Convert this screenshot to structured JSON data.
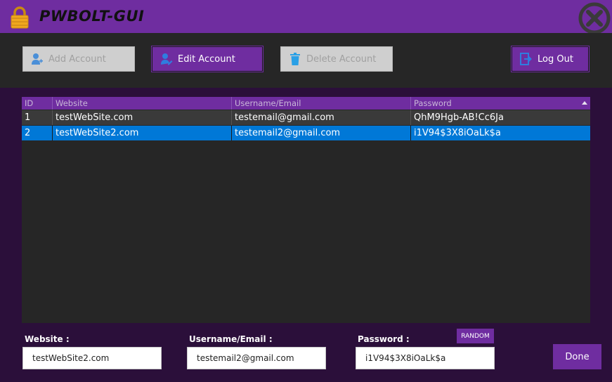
{
  "window": {
    "title": "PWBOLT-GUI",
    "close_icon": "close-x-circle-icon",
    "lock_icon": "padlock-icon"
  },
  "toolbar": {
    "add_label": "Add Account",
    "edit_label": "Edit Account",
    "delete_label": "Delete Account",
    "logout_label": "Log Out"
  },
  "table": {
    "columns": [
      "ID",
      "Website",
      "Username/Email",
      "Password"
    ],
    "sort_column": "Password",
    "rows": [
      {
        "id": "1",
        "website": "testWebSite.com",
        "email": "testemail@gmail.com",
        "password": "QhM9Hgb-AB!Cc6Ja"
      },
      {
        "id": "2",
        "website": "testWebSite2.com",
        "email": "testemail2@gmail.com",
        "password": "i1V94$3X8iOaLk$a"
      }
    ],
    "selected_row": "2"
  },
  "form": {
    "website_label": "Website :",
    "website_value": "testWebSite2.com",
    "email_label": "Username/Email :",
    "email_value": "testemail2@gmail.com",
    "password_label": "Password :",
    "password_value": "i1V94$3X8iOaLk$a",
    "random_label": "RANDOM",
    "done_label": "Done"
  },
  "colors": {
    "accent": "#6f2da0",
    "background": "#2b0f3a",
    "panel": "#262626",
    "row_selected": "#0078d7",
    "row_normal": "#3a3a3a"
  }
}
